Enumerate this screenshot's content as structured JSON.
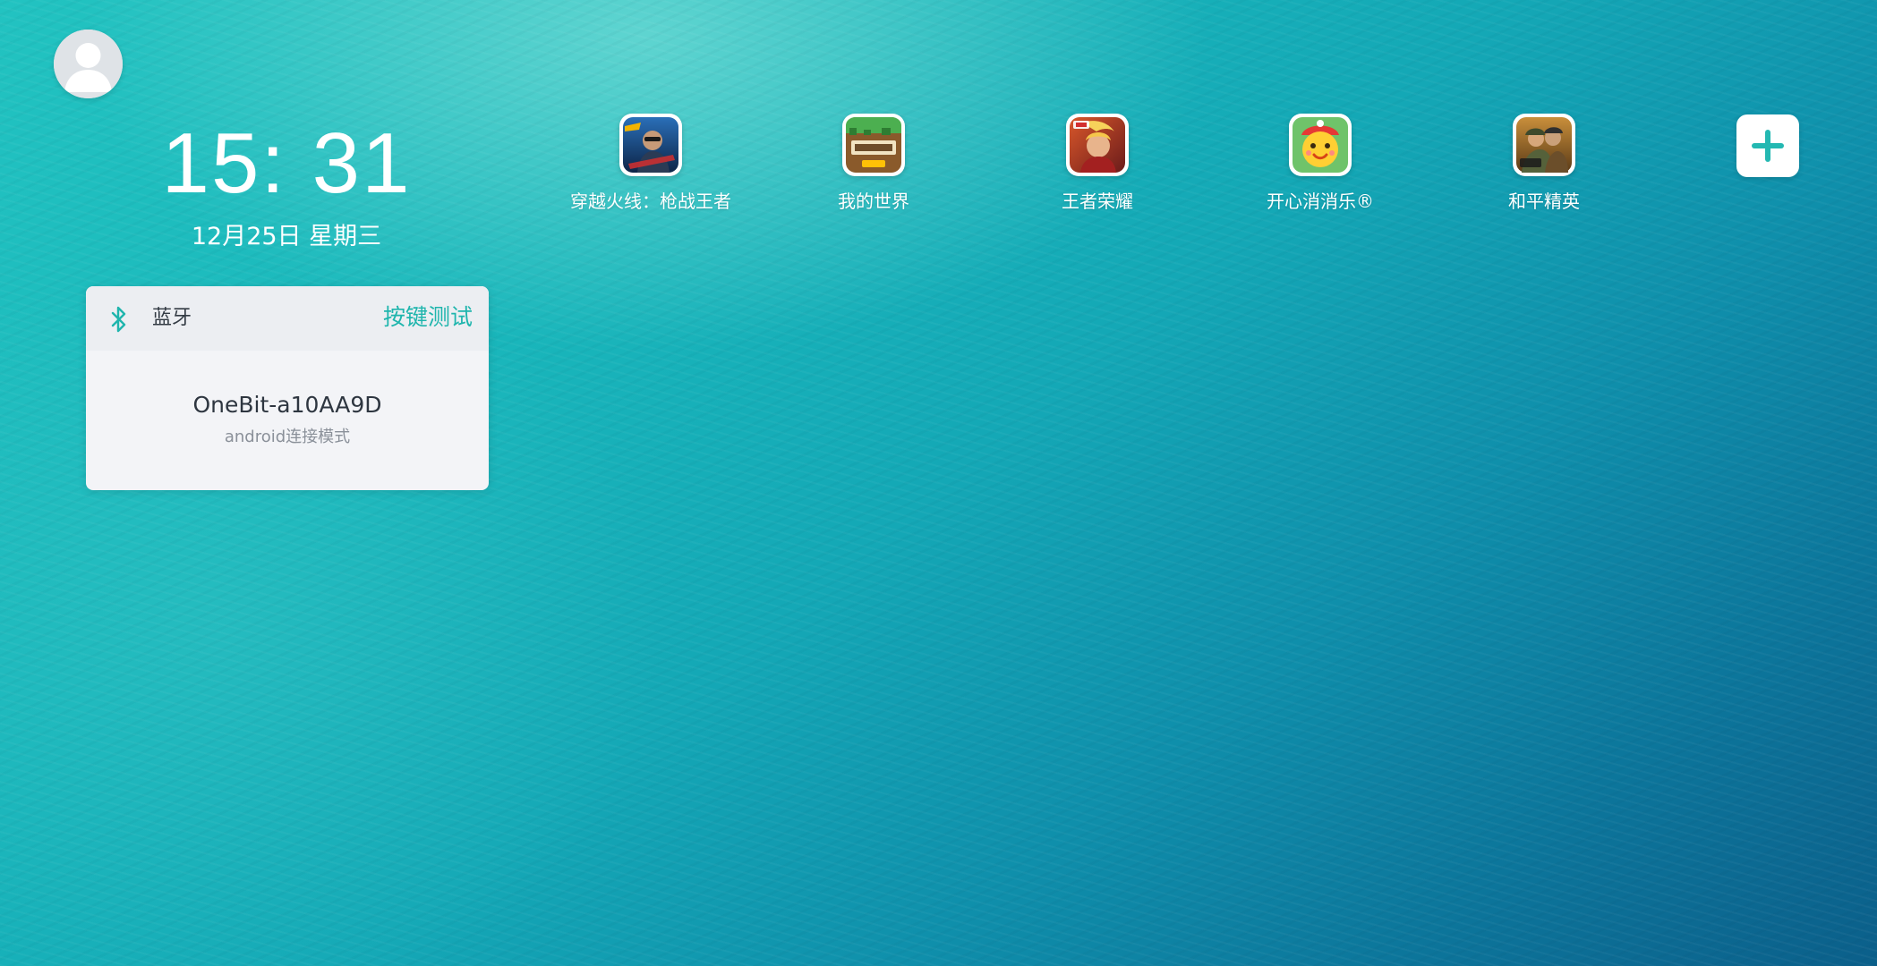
{
  "status": {
    "time": "15: 31",
    "date": "12月25日 星期三"
  },
  "profile": {
    "avatar_icon": "user-avatar-icon"
  },
  "bluetooth_card": {
    "icon": "bluetooth-icon",
    "title": "蓝牙",
    "action_label": "按键测试",
    "device_name": "OneBit-a10AA9D",
    "device_mode": "android连接模式",
    "accent_color": "#1fb5ad"
  },
  "apps": [
    {
      "label": "穿越火线：枪战王者",
      "icon": "crossfire-game-icon"
    },
    {
      "label": "我的世界",
      "icon": "minecraft-game-icon"
    },
    {
      "label": "王者荣耀",
      "icon": "honor-of-kings-game-icon"
    },
    {
      "label": "开心消消乐®",
      "icon": "happy-elimination-game-icon"
    },
    {
      "label": "和平精英",
      "icon": "game-for-peace-icon"
    }
  ],
  "add_app": {
    "icon": "plus-icon"
  },
  "wallpaper": {
    "colors": [
      "#22c3c1",
      "#14a8b6",
      "#0c749a",
      "#0b5f8a"
    ]
  }
}
